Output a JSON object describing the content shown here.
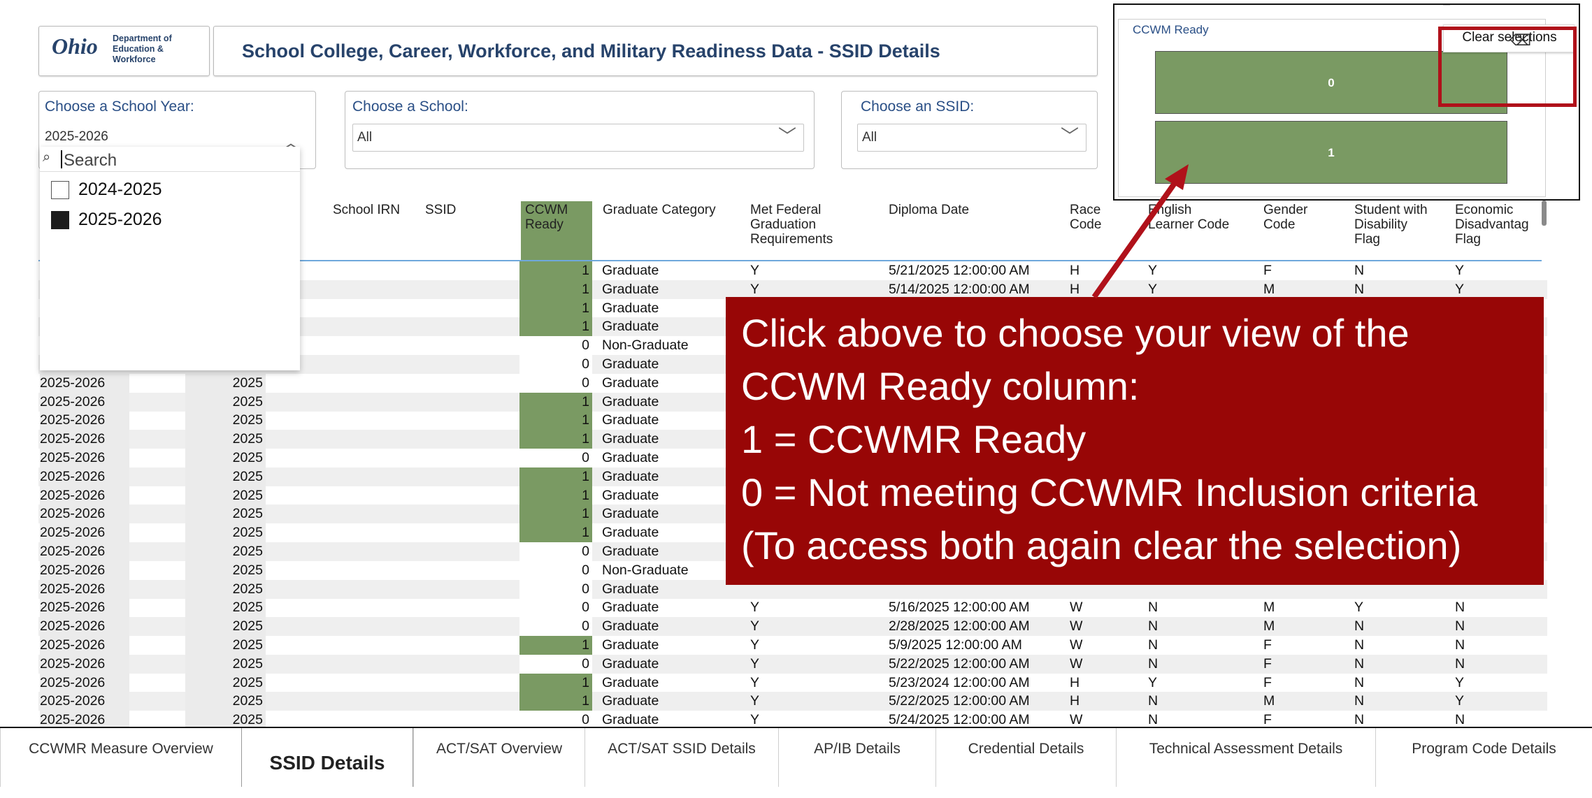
{
  "header": {
    "logo_script": "Ohio",
    "logo_dept": "Department of\nEducation &\nWorkforce",
    "title": "School College, Career, Workforce, and Military Readiness Data - SSID Details"
  },
  "slicers": {
    "year": {
      "title": "Choose a School Year:",
      "value": "2025-2026"
    },
    "school": {
      "title": "Choose a School:",
      "value": "All"
    },
    "ssid": {
      "title": "Choose an SSID:",
      "value": "All"
    }
  },
  "dropdown": {
    "search_placeholder": "Search",
    "options": [
      {
        "label": "2024-2025",
        "checked": false
      },
      {
        "label": "2025-2026",
        "checked": true
      }
    ]
  },
  "table": {
    "headers": {
      "rn_partial": "RN",
      "school_irn": "School IRN",
      "ssid": "SSID",
      "ccwm": "CCWM\nReady",
      "grad_cat": "Graduate Category",
      "met_fed": "Met Federal\nGraduation\nRequirements",
      "diploma": "Diploma Date",
      "race": "Race\nCode",
      "english": "English\nLearner Code",
      "gender": "Gender\nCode",
      "disability": "Student with\nDisability\nFlag",
      "econ": "Economic\nDisadvantag\nFlag"
    },
    "rows": [
      {
        "year": "",
        "yr": "",
        "ccwm": "1",
        "cat": "Graduate",
        "met": "Y",
        "date": "5/21/2025 12:00:00 AM",
        "race": "H",
        "eng": "Y",
        "gender": "F",
        "dis": "N",
        "econ": "Y"
      },
      {
        "year": "",
        "yr": "",
        "ccwm": "1",
        "cat": "Graduate",
        "met": "Y",
        "date": "5/14/2025 12:00:00 AM",
        "race": "H",
        "eng": "Y",
        "gender": "M",
        "dis": "N",
        "econ": "Y"
      },
      {
        "year": "",
        "yr": "",
        "ccwm": "1",
        "cat": "Graduate",
        "met": "",
        "date": "",
        "race": "",
        "eng": "",
        "gender": "",
        "dis": "",
        "econ": ""
      },
      {
        "year": "",
        "yr": "",
        "ccwm": "1",
        "cat": "Graduate",
        "met": "",
        "date": "",
        "race": "",
        "eng": "",
        "gender": "",
        "dis": "",
        "econ": ""
      },
      {
        "year": "",
        "yr": "",
        "ccwm": "0",
        "cat": "Non-Graduate",
        "met": "",
        "date": "",
        "race": "",
        "eng": "",
        "gender": "",
        "dis": "",
        "econ": ""
      },
      {
        "year": "",
        "yr": "",
        "ccwm": "0",
        "cat": "Graduate",
        "met": "",
        "date": "",
        "race": "",
        "eng": "",
        "gender": "",
        "dis": "",
        "econ": ""
      },
      {
        "year": "2025-2026",
        "yr": "2025",
        "ccwm": "0",
        "cat": "Graduate",
        "met": "",
        "date": "",
        "race": "",
        "eng": "",
        "gender": "",
        "dis": "",
        "econ": ""
      },
      {
        "year": "2025-2026",
        "yr": "2025",
        "ccwm": "1",
        "cat": "Graduate",
        "met": "",
        "date": "",
        "race": "",
        "eng": "",
        "gender": "",
        "dis": "",
        "econ": ""
      },
      {
        "year": "2025-2026",
        "yr": "2025",
        "ccwm": "1",
        "cat": "Graduate",
        "met": "",
        "date": "",
        "race": "",
        "eng": "",
        "gender": "",
        "dis": "",
        "econ": ""
      },
      {
        "year": "2025-2026",
        "yr": "2025",
        "ccwm": "1",
        "cat": "Graduate",
        "met": "",
        "date": "",
        "race": "",
        "eng": "",
        "gender": "",
        "dis": "",
        "econ": ""
      },
      {
        "year": "2025-2026",
        "yr": "2025",
        "ccwm": "0",
        "cat": "Graduate",
        "met": "",
        "date": "",
        "race": "",
        "eng": "",
        "gender": "",
        "dis": "",
        "econ": ""
      },
      {
        "year": "2025-2026",
        "yr": "2025",
        "ccwm": "1",
        "cat": "Graduate",
        "met": "",
        "date": "",
        "race": "",
        "eng": "",
        "gender": "",
        "dis": "",
        "econ": ""
      },
      {
        "year": "2025-2026",
        "yr": "2025",
        "ccwm": "1",
        "cat": "Graduate",
        "met": "",
        "date": "",
        "race": "",
        "eng": "",
        "gender": "",
        "dis": "",
        "econ": ""
      },
      {
        "year": "2025-2026",
        "yr": "2025",
        "ccwm": "1",
        "cat": "Graduate",
        "met": "",
        "date": "",
        "race": "",
        "eng": "",
        "gender": "",
        "dis": "",
        "econ": ""
      },
      {
        "year": "2025-2026",
        "yr": "2025",
        "ccwm": "1",
        "cat": "Graduate",
        "met": "",
        "date": "",
        "race": "",
        "eng": "",
        "gender": "",
        "dis": "",
        "econ": ""
      },
      {
        "year": "2025-2026",
        "yr": "2025",
        "ccwm": "0",
        "cat": "Graduate",
        "met": "",
        "date": "",
        "race": "",
        "eng": "",
        "gender": "",
        "dis": "",
        "econ": ""
      },
      {
        "year": "2025-2026",
        "yr": "2025",
        "ccwm": "0",
        "cat": "Non-Graduate",
        "met": "",
        "date": "",
        "race": "",
        "eng": "",
        "gender": "",
        "dis": "",
        "econ": ""
      },
      {
        "year": "2025-2026",
        "yr": "2025",
        "ccwm": "0",
        "cat": "Graduate",
        "met": "",
        "date": "",
        "race": "",
        "eng": "",
        "gender": "",
        "dis": "",
        "econ": ""
      },
      {
        "year": "2025-2026",
        "yr": "2025",
        "ccwm": "0",
        "cat": "Graduate",
        "met": "Y",
        "date": "5/16/2025 12:00:00 AM",
        "race": "W",
        "eng": "N",
        "gender": "M",
        "dis": "Y",
        "econ": "N"
      },
      {
        "year": "2025-2026",
        "yr": "2025",
        "ccwm": "0",
        "cat": "Graduate",
        "met": "Y",
        "date": "2/28/2025 12:00:00 AM",
        "race": "W",
        "eng": "N",
        "gender": "M",
        "dis": "N",
        "econ": "N"
      },
      {
        "year": "2025-2026",
        "yr": "2025",
        "ccwm": "1",
        "cat": "Graduate",
        "met": "Y",
        "date": "5/9/2025 12:00:00 AM",
        "race": "W",
        "eng": "N",
        "gender": "F",
        "dis": "N",
        "econ": "N"
      },
      {
        "year": "2025-2026",
        "yr": "2025",
        "ccwm": "0",
        "cat": "Graduate",
        "met": "Y",
        "date": "5/22/2025 12:00:00 AM",
        "race": "W",
        "eng": "N",
        "gender": "F",
        "dis": "N",
        "econ": "N"
      },
      {
        "year": "2025-2026",
        "yr": "2025",
        "ccwm": "1",
        "cat": "Graduate",
        "met": "Y",
        "date": "5/23/2024 12:00:00 AM",
        "race": "H",
        "eng": "Y",
        "gender": "F",
        "dis": "N",
        "econ": "Y"
      },
      {
        "year": "2025-2026",
        "yr": "2025",
        "ccwm": "1",
        "cat": "Graduate",
        "met": "Y",
        "date": "5/22/2025 12:00:00 AM",
        "race": "H",
        "eng": "N",
        "gender": "M",
        "dis": "N",
        "econ": "Y"
      },
      {
        "year": "2025-2026",
        "yr": "2025",
        "ccwm": "0",
        "cat": "Graduate",
        "met": "Y",
        "date": "5/24/2025 12:00:00 AM",
        "race": "W",
        "eng": "N",
        "gender": "F",
        "dis": "N",
        "econ": "N"
      }
    ]
  },
  "visual": {
    "title": "CCWM Ready",
    "bars": [
      "0",
      "1"
    ],
    "tooltip": "Clear selections",
    "eraser_icon": "eraser-icon"
  },
  "callout": {
    "lines": [
      "Click above to choose your view of the",
      "CCWM Ready column:",
      "1 = CCWMR Ready",
      "0 = Not meeting CCWMR Inclusion criteria",
      "(To access both again clear the selection)"
    ]
  },
  "tabs": [
    {
      "label": "CCWMR Measure Overview",
      "active": false
    },
    {
      "label": "SSID Details",
      "active": true
    },
    {
      "label": "ACT/SAT Overview",
      "active": false
    },
    {
      "label": "ACT/SAT SSID Details",
      "active": false
    },
    {
      "label": "AP/IB Details",
      "active": false
    },
    {
      "label": "Credential Details",
      "active": false
    },
    {
      "label": "Technical Assessment Details",
      "active": false
    },
    {
      "label": "Program Code Details",
      "active": false
    }
  ],
  "colors": {
    "accent_green": "#7a9a63",
    "callout_red": "#980606",
    "title_blue": "#27436b",
    "highlight_red": "#b0111a"
  }
}
